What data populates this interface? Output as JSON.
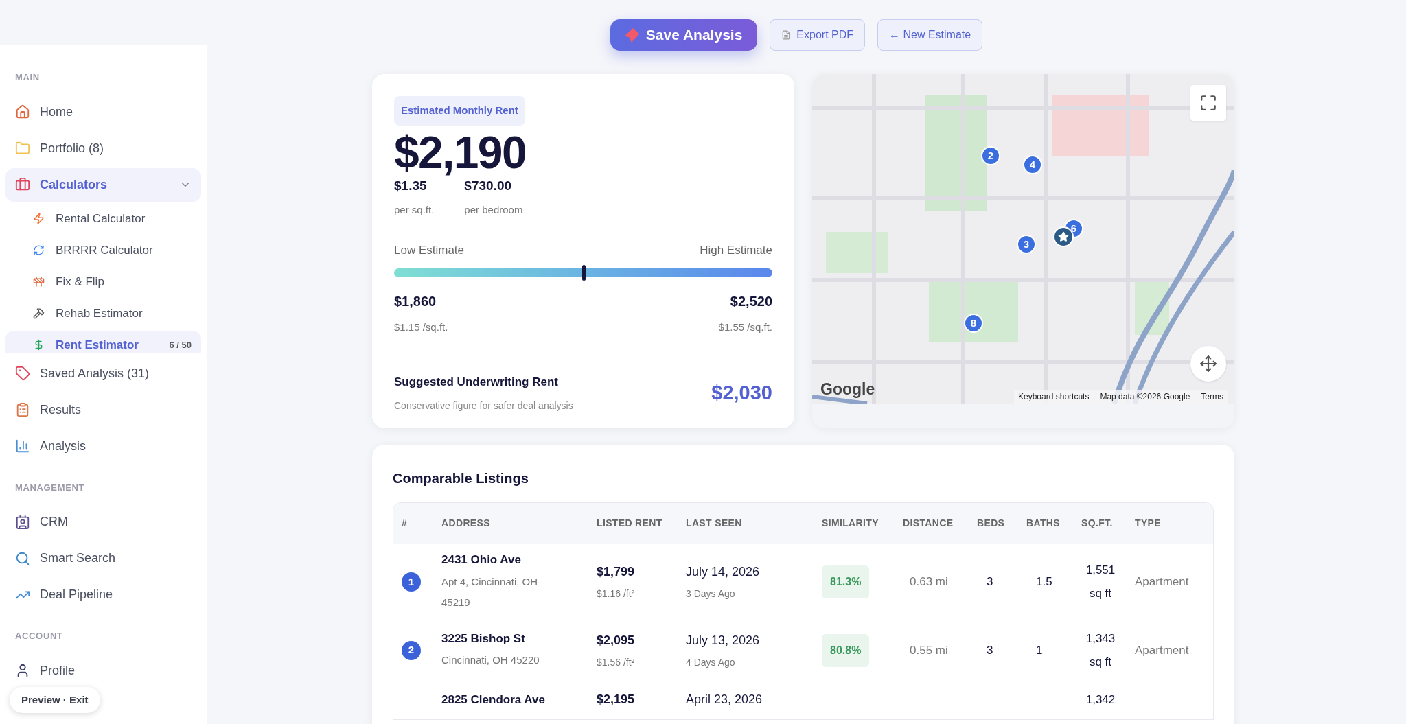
{
  "top_actions": [
    {
      "label": "Save Analysis",
      "kind": "primary"
    },
    {
      "label": "Export PDF",
      "kind": "secondary"
    },
    {
      "label": "← New Estimate",
      "kind": "secondary"
    }
  ],
  "sidebar": {
    "sections": [
      {
        "title": "MAIN",
        "items": [
          {
            "label": "Home",
            "selected": false
          },
          {
            "label": "Portfolio (8)",
            "selected": false
          },
          {
            "label": "Calculators",
            "selected": true,
            "expanded": true,
            "children": [
              {
                "label": "Rental Calculator",
                "selected": false
              },
              {
                "label": "BRRRR Calculator",
                "selected": false
              },
              {
                "label": "Fix & Flip",
                "selected": false
              },
              {
                "label": "Rehab Estimator",
                "selected": false
              },
              {
                "label": "Rent Estimator",
                "selected": true,
                "badge": "6 / 50"
              }
            ]
          },
          {
            "label": "Saved Analysis (31)",
            "selected": false
          },
          {
            "label": "Results",
            "selected": false
          },
          {
            "label": "Analysis",
            "selected": false
          }
        ]
      },
      {
        "title": "MANAGEMENT",
        "items": [
          {
            "label": "CRM",
            "selected": false
          },
          {
            "label": "Smart Search",
            "selected": false
          },
          {
            "label": "Deal Pipeline",
            "selected": false
          }
        ]
      },
      {
        "title": "ACCOUNT",
        "items": [
          {
            "label": "Profile",
            "selected": false
          }
        ]
      }
    ],
    "preview_pill": "Preview · Exit"
  },
  "estimate": {
    "badge": "Estimated Monthly Rent",
    "amount": "$2,190",
    "metrics": [
      {
        "value": "$1.35",
        "label": "per sq.ft."
      },
      {
        "value": "$730.00",
        "label": "per bedroom"
      }
    ],
    "range": {
      "low_label": "Low Estimate",
      "high_label": "High Estimate",
      "level": 0.5,
      "low_value": "$1,860",
      "low_sub": "$1.15 /sq.ft.",
      "high_value": "$2,520",
      "high_sub": "$1.55 /sq.ft."
    },
    "suggested": {
      "title": "Suggested Underwriting Rent",
      "note": "Conservative figure for safer deal analysis",
      "value": "$2,030"
    }
  },
  "map": {
    "kind": "picture",
    "logo": "Google",
    "markers": [
      {
        "kind": "number",
        "label": "2"
      },
      {
        "kind": "number",
        "label": "4"
      },
      {
        "kind": "number",
        "label": "6"
      },
      {
        "kind": "subject"
      },
      {
        "kind": "number",
        "label": "3"
      },
      {
        "kind": "number",
        "label": "8"
      }
    ],
    "attribution": [
      "Keyboard shortcuts",
      "Map data ©2026 Google",
      "Terms"
    ]
  },
  "comparables": {
    "title": "Comparable Listings",
    "columns": [
      "#",
      "ADDRESS",
      "LISTED RENT",
      "LAST SEEN",
      "SIMILARITY",
      "DISTANCE",
      "BEDS",
      "BATHS",
      "SQ.FT.",
      "TYPE"
    ],
    "rows": [
      {
        "number": "1",
        "street": "2431 Ohio Ave",
        "city": "Apt 4, Cincinnati, OH 45219",
        "rent": "$1,799",
        "rent_per_ft": "$1.16 /ft²",
        "date": "July 14, 2026",
        "ago": "3 Days Ago",
        "similarity": "81.3%",
        "distance": "0.63 mi",
        "beds": "3",
        "baths": "1.5",
        "sqft": "1,551 sq ft",
        "type": "Apartment"
      },
      {
        "number": "2",
        "street": "3225 Bishop St",
        "city": "Cincinnati, OH 45220",
        "rent": "$2,095",
        "rent_per_ft": "$1.56 /ft²",
        "date": "July 13, 2026",
        "ago": "4 Days Ago",
        "similarity": "80.8%",
        "distance": "0.55 mi",
        "beds": "3",
        "baths": "1",
        "sqft": "1,343 sq ft",
        "type": "Apartment"
      },
      {
        "street": "2825 Clendora Ave",
        "rent": "$2,195",
        "date": "April 23, 2026",
        "sqft": "1,342"
      }
    ]
  }
}
